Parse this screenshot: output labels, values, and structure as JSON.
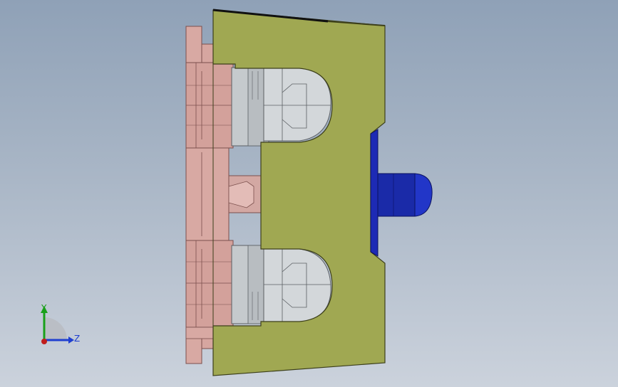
{
  "scene": {
    "type": "cad-3d-viewport",
    "background_top": "#8fa1b7",
    "background_bottom": "#cbd2dc",
    "colors": {
      "bracket": "#a0a852",
      "bracket_edge": "#3c3f1a",
      "flange": "#d8a9a3",
      "flange_edge": "#7b4f4c",
      "nut": "#cfd3d6",
      "nut_edge": "#5b5f63",
      "knob": "#1a2aa8",
      "knob_edge": "#0b1260"
    }
  },
  "triad": {
    "y_label": "Y",
    "z_label": "Z",
    "y_color": "#19a019",
    "z_color": "#1f3fd0",
    "x_color": "#c01c1c"
  }
}
